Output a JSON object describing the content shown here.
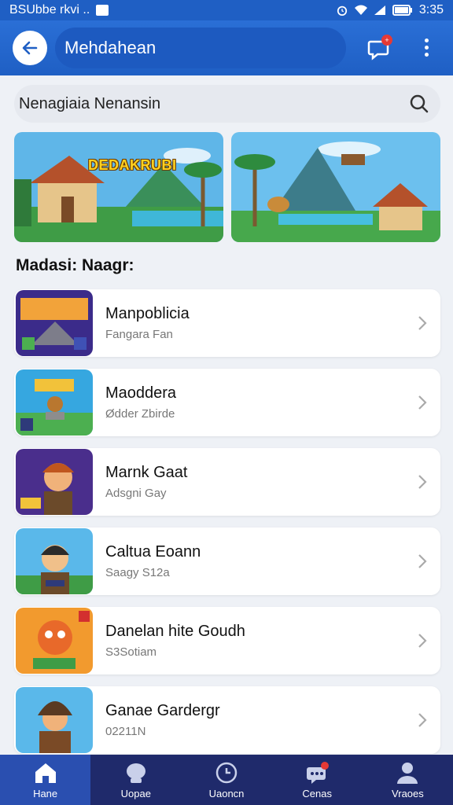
{
  "status_bar": {
    "left_text": "BSUbbe rkvi ..",
    "time": "3:35"
  },
  "app_bar": {
    "title": "Mehdahean"
  },
  "search": {
    "placeholder": "Nenagiaia Nenansin"
  },
  "banners": [
    {
      "title": "DEDAKRUBI"
    },
    {
      "title": ""
    }
  ],
  "section": {
    "title": "Madasi: Naagr:"
  },
  "games": [
    {
      "name": "Manpoblicia",
      "subtitle": "Fangara Fan"
    },
    {
      "name": "Maoddera",
      "subtitle": "Ødder Zbirde"
    },
    {
      "name": "Marnk Gaat",
      "subtitle": "Adsgni Gay"
    },
    {
      "name": "Caltua Eoann",
      "subtitle": "Saagy S12a"
    },
    {
      "name": "Danelan hite Goudh",
      "subtitle": "S3Sotiam"
    },
    {
      "name": "Ganae Gardergr",
      "subtitle": "02211N"
    }
  ],
  "nav": [
    {
      "label": "Hane",
      "icon": "home-icon"
    },
    {
      "label": "Uopae",
      "icon": "user-blob-icon"
    },
    {
      "label": "Uaoncn",
      "icon": "clock-icon"
    },
    {
      "label": "Cenas",
      "icon": "chat-icon"
    },
    {
      "label": "Vraoes",
      "icon": "person-icon"
    }
  ],
  "colors": {
    "primary": "#1f5fc4",
    "nav_bg": "#1f2a6b",
    "nav_active": "#2a4fb0",
    "badge": "#e53935"
  }
}
